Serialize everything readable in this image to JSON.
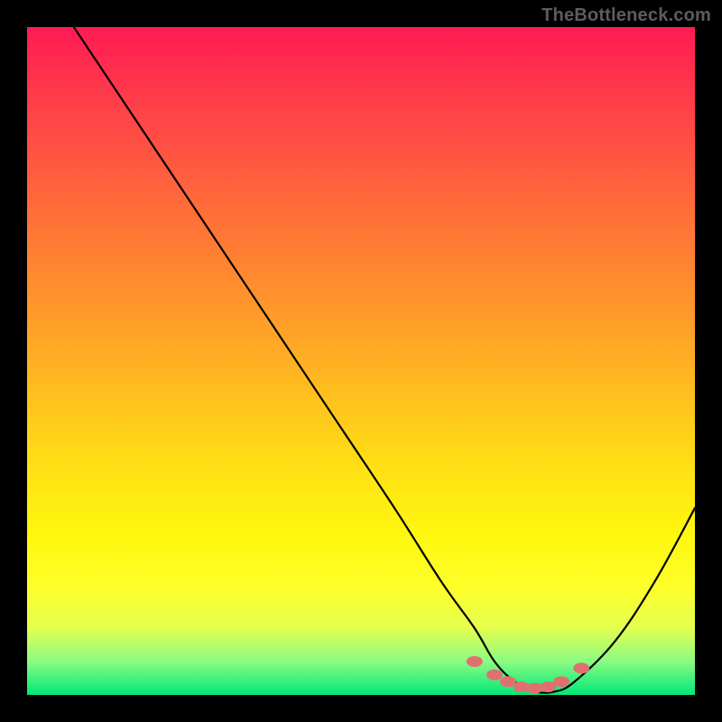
{
  "watermark": "TheBottleneck.com",
  "chart_data": {
    "type": "line",
    "title": "",
    "xlabel": "",
    "ylabel": "",
    "xlim": [
      0,
      100
    ],
    "ylim": [
      0,
      100
    ],
    "grid": false,
    "legend": false,
    "series": [
      {
        "name": "bottleneck-curve",
        "x": [
          7,
          15,
          25,
          35,
          45,
          55,
          62,
          67,
          70,
          73,
          76,
          79,
          82,
          88,
          94,
          100
        ],
        "y": [
          100,
          88,
          73,
          58,
          43,
          28,
          17,
          10,
          5,
          2,
          0.5,
          0.5,
          2,
          8,
          17,
          28
        ],
        "color": "#000000"
      }
    ],
    "markers": {
      "name": "bottom-dots",
      "color": "#e07070",
      "points": [
        {
          "x": 67,
          "y": 5.0
        },
        {
          "x": 70,
          "y": 3.0
        },
        {
          "x": 72,
          "y": 2.0
        },
        {
          "x": 74,
          "y": 1.2
        },
        {
          "x": 76,
          "y": 1.0
        },
        {
          "x": 78,
          "y": 1.2
        },
        {
          "x": 80,
          "y": 2.0
        },
        {
          "x": 83,
          "y": 4.0
        }
      ]
    },
    "gradient_stops": [
      {
        "pos": 0,
        "color": "#ff1a54"
      },
      {
        "pos": 50,
        "color": "#ffc21d"
      },
      {
        "pos": 85,
        "color": "#feff2a"
      },
      {
        "pos": 100,
        "color": "#00e878"
      }
    ]
  }
}
